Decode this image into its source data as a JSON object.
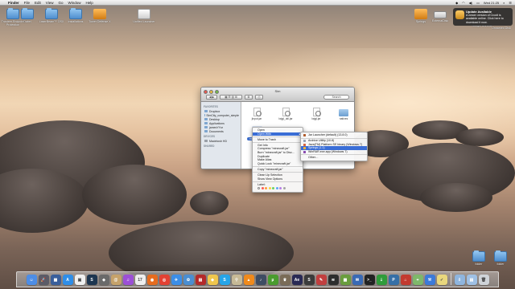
{
  "menubar": {
    "apple_glyph": "",
    "app_name": "Finder",
    "items": [
      "File",
      "Edit",
      "View",
      "Go",
      "Window",
      "Help"
    ],
    "clock": "Wed 21:25"
  },
  "desktop_icons_left": [
    {
      "label": "Trusteer Endpoint Protection",
      "kind": "folder"
    },
    {
      "label": "Dabel",
      "kind": "folder"
    },
    {
      "label": "LaserBeam™ OSX",
      "kind": "folder"
    },
    {
      "label": "Installations",
      "kind": "folder"
    },
    {
      "label": "Tower Defense X",
      "kind": "app-orange"
    },
    {
      "label": "Unified Launcher",
      "kind": "app-tools"
    }
  ],
  "desktop_icons_right": [
    {
      "label": "Springs",
      "kind": "app-orange"
    },
    {
      "label": "ExternalDisk",
      "kind": "drive"
    }
  ],
  "desktop_icons_far_right": [
    {
      "label": "Google Chrome",
      "kind": "folder"
    },
    {
      "label": "Unnamed Disk",
      "kind": "drive"
    }
  ],
  "desktop_icons_bottom_right": [
    {
      "label": "folder",
      "kind": "folder"
    },
    {
      "label": "folder",
      "kind": "folder"
    }
  ],
  "notification": {
    "title": "Update Available",
    "body": "A newer version of Croxit is available online. Click here to download it now."
  },
  "finder": {
    "title": "Sim",
    "toolbar": [
      "◀ ▶",
      "▦ ☰ ▥ ⊞",
      "⚙",
      "⎙"
    ],
    "search_placeholder": "Search",
    "sidebar": {
      "favorites_heading": "FAVORITES",
      "favorites": [
        "Dropbox",
        "SimCity_computer_simple",
        "Desktop",
        "Applications",
        "jamesYYur",
        "Documents"
      ],
      "devices_heading": "DEVICES",
      "devices": [
        "Macintosh HD"
      ],
      "shared_heading": "SHARED"
    },
    "files": [
      {
        "label": "jinput.jar",
        "type": "jar"
      },
      {
        "label": "lwjgl_util.jar",
        "type": "jar"
      },
      {
        "label": "lwjgl.jar",
        "type": "jar"
      },
      {
        "label": "natives",
        "type": "folder"
      },
      {
        "label": "minecraft.jar",
        "type": "jar",
        "selected": true
      },
      {
        "label": "",
        "type": "folder"
      }
    ]
  },
  "context_menu": {
    "items": [
      {
        "label": "Open"
      },
      {
        "label": "Open With",
        "submenu": true,
        "active": true
      },
      {
        "sep": true
      },
      {
        "label": "Move to Trash"
      },
      {
        "sep": true
      },
      {
        "label": "Get Info"
      },
      {
        "label": "Compress \"minecraft.jar\""
      },
      {
        "label": "Burn \"minecraft.jar\" to Disc…"
      },
      {
        "label": "Duplicate"
      },
      {
        "label": "Make Alias"
      },
      {
        "label": "Quick Look \"minecraft.jar\""
      },
      {
        "sep": true
      },
      {
        "label": "Copy \"minecraft.jar\""
      },
      {
        "sep": true
      },
      {
        "label": "Clean Up Selection"
      },
      {
        "label": "Show View Options"
      },
      {
        "sep": true
      },
      {
        "label": "Label:"
      }
    ],
    "tag_colors": [
      "#ff5a52",
      "#ff9f3a",
      "#f7d443",
      "#6bd260",
      "#5aa7f7",
      "#b77ee6",
      "#a5a5a5"
    ]
  },
  "submenu": {
    "items": [
      {
        "label": "Jar Launcher (default) (13.8.0)",
        "color": "#b05b2b"
      },
      {
        "sep": true
      },
      {
        "label": "Archive Utility (10.8)",
        "color": "#9aa4b5"
      },
      {
        "label": "Java(TM) Platform SE binary (Windows 7)",
        "color": "#d9643b"
      },
      {
        "label": "Springs (1.1)",
        "color": "#f2b33d",
        "active": true
      },
      {
        "label": "WinRAR.exe.app (Windows 7)",
        "color": "#8a4bb0"
      },
      {
        "sep": true
      },
      {
        "label": "Other…"
      }
    ]
  },
  "dock": {
    "items": [
      {
        "name": "finder-icon",
        "color": "#4d8de6",
        "glyph": "☺"
      },
      {
        "name": "launchpad-icon",
        "color": "#5b5b67",
        "glyph": "🚀"
      },
      {
        "name": "mission-control-icon",
        "color": "#3a5f9b",
        "glyph": "▦"
      },
      {
        "name": "app-store-icon",
        "color": "#2f8ee8",
        "glyph": "A"
      },
      {
        "name": "preview-icon",
        "color": "#f0f0f0",
        "glyph": "▣"
      },
      {
        "name": "steam-icon",
        "color": "#1e3650",
        "glyph": "S"
      },
      {
        "name": "photos-icon",
        "color": "#6a6a6a",
        "glyph": "◈"
      },
      {
        "name": "contacts-icon",
        "color": "#c6a26a",
        "glyph": "@"
      },
      {
        "name": "itunes-icon",
        "color": "#9c4fd6",
        "glyph": "♫"
      },
      {
        "name": "calendar-icon",
        "color": "#eeeeee",
        "glyph": "17"
      },
      {
        "name": "firefox-icon",
        "color": "#e66b1e",
        "glyph": "◉"
      },
      {
        "name": "chrome-icon",
        "color": "#e34133",
        "glyph": "◎"
      },
      {
        "name": "safari-icon",
        "color": "#3c8ee7",
        "glyph": "✈"
      },
      {
        "name": "iphoto-icon",
        "color": "#4b8ed1",
        "glyph": "✿"
      },
      {
        "name": "photo-booth-icon",
        "color": "#b42a2a",
        "glyph": "▤"
      },
      {
        "name": "sketch-icon",
        "color": "#f0c64d",
        "glyph": "◆"
      },
      {
        "name": "skype-icon",
        "color": "#26a5e8",
        "glyph": "S"
      },
      {
        "name": "keychain-icon",
        "color": "#c7b996",
        "glyph": "⚲"
      },
      {
        "name": "vlc-icon",
        "color": "#f08a1c",
        "glyph": "▲"
      },
      {
        "name": "teamspeak-icon",
        "color": "#3f4d63",
        "glyph": "♪"
      },
      {
        "name": "utorrent-icon",
        "color": "#4a9c2f",
        "glyph": "µ"
      },
      {
        "name": "trophy-icon",
        "color": "#7a6b57",
        "glyph": "♛"
      },
      {
        "name": "aftereffects-icon",
        "color": "#2a2a55",
        "glyph": "Ae"
      },
      {
        "name": "sublime-icon",
        "color": "#3b3b3b",
        "glyph": "S"
      },
      {
        "name": "pen-icon",
        "color": "#c23f3f",
        "glyph": "✎"
      },
      {
        "name": "spotify-icon",
        "color": "#2d2d2d",
        "glyph": "≋"
      },
      {
        "name": "minecraft-icon",
        "color": "#6a9d3e",
        "glyph": "▩"
      },
      {
        "name": "thunderbird-icon",
        "color": "#3a6ab5",
        "glyph": "✉"
      },
      {
        "name": "terminal-icon",
        "color": "#222222",
        "glyph": ">_"
      },
      {
        "name": "torrent-icon",
        "color": "#2f9c3a",
        "glyph": "⇣"
      },
      {
        "name": "python-icon",
        "color": "#366fa6",
        "glyph": "P"
      },
      {
        "name": "pdf-icon",
        "color": "#c33a2f",
        "glyph": "⌂"
      },
      {
        "name": "maps-icon",
        "color": "#7fb86a",
        "glyph": "⌖"
      },
      {
        "name": "xcode-icon",
        "color": "#3c7ad9",
        "glyph": "⚒"
      },
      {
        "name": "notes-icon",
        "color": "#e9d77d",
        "glyph": "✓"
      },
      {
        "name": "downloads-stack-icon",
        "color": "#8fb5de",
        "glyph": "⇩"
      },
      {
        "name": "documents-stack-icon",
        "color": "#9fc0e4",
        "glyph": "▤"
      },
      {
        "name": "trash-icon",
        "color": "#cfd3d8",
        "glyph": "🗑"
      }
    ]
  }
}
